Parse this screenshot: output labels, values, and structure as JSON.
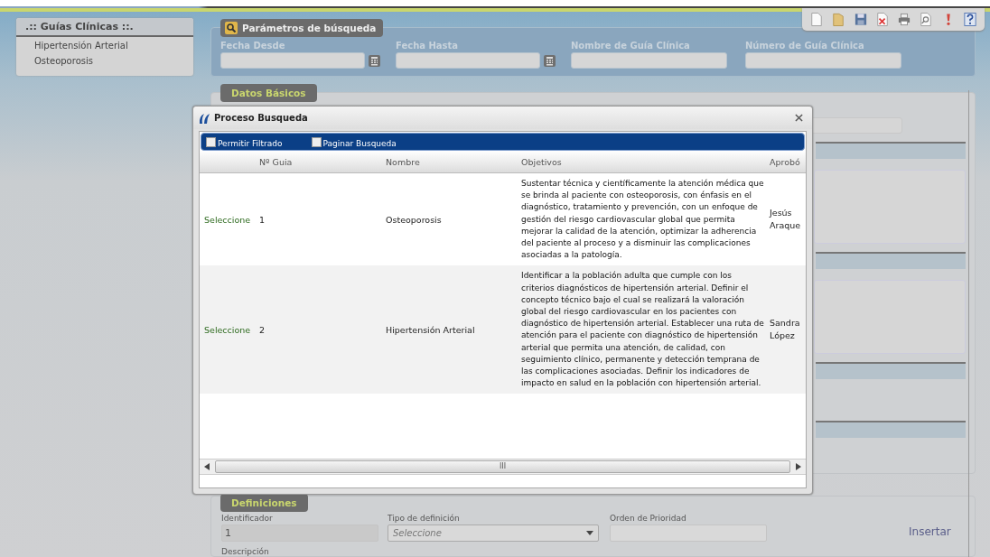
{
  "sidebar": {
    "title": ".:: Guías Clínicas ::.",
    "items": [
      {
        "label": "Hipertensión Arterial",
        "selected": false
      },
      {
        "label": "Osteoporosis",
        "selected": false
      }
    ]
  },
  "toolbar": {
    "buttons": [
      {
        "kind": "new"
      },
      {
        "kind": "open"
      },
      {
        "kind": "save"
      },
      {
        "kind": "delete"
      },
      {
        "kind": "print"
      },
      {
        "kind": "preview"
      },
      {
        "kind": "alert"
      },
      {
        "kind": "help"
      }
    ]
  },
  "search": {
    "legend": "Parámetros de búsqueda",
    "fields": [
      {
        "label": "Fecha Desde",
        "kind": "date"
      },
      {
        "label": "Fecha Hasta",
        "kind": "date"
      },
      {
        "label": "Nombre de Guía Clínica",
        "kind": "text"
      },
      {
        "label": "Número de Guía Clínica",
        "kind": "text"
      }
    ]
  },
  "basic_data": {
    "legend": "Datos Básicos"
  },
  "definitions": {
    "legend": "Definiciones",
    "fields": [
      {
        "label": "Identificador",
        "kind": "text",
        "value": "1",
        "disabled": true
      },
      {
        "label": "Tipo de definición",
        "kind": "select",
        "placeholder": "Seleccione",
        "disabled": false
      },
      {
        "label": "Orden de Prioridad",
        "kind": "text",
        "disabled": false
      }
    ],
    "insert_link": "Insertar",
    "description_label": "Descripción"
  },
  "dialog": {
    "title": "Proceso Busqueda",
    "options": [
      {
        "label": "Permitir Filtrado",
        "checked": false
      },
      {
        "label": "Paginar Busqueda",
        "checked": false
      }
    ],
    "columns": [
      "Nº Guia",
      "Nombre",
      "Objetivos",
      "Aprobó"
    ],
    "rows": [
      {
        "action": "Seleccione",
        "number": "1",
        "name": "Osteoporosis",
        "objectives": "Sustentar técnica y científicamente la atención médica que se brinda al paciente con osteoporosis, con énfasis en el diagnóstico, tratamiento y prevención, con un enfoque de gestión del riesgo cardiovascular global que permita mejorar la calidad de la atención, optimizar la adherencia del paciente al proceso y a disminuir las complicaciones asociadas a la patología.",
        "approved_by": "Jesús Araque"
      },
      {
        "action": "Seleccione",
        "number": "2",
        "name": "Hipertensión Arterial",
        "objectives": "Identificar a la población adulta que cumple con los criterios diagnósticos de hipertensión arterial. Definir el concepto técnico bajo el cual se realizará la valoración global del riesgo cardiovascular en los pacientes con diagnóstico de hipertensión arterial. Establecer una ruta de atención para el paciente con diagnóstico de hipertensión arterial que permita una atención, de calidad, con seguimiento clínico, permanente y detección temprana de las complicaciones asociadas. Definir los indicadores de impacto en salud en la población con hipertensión arterial.",
        "approved_by": "Sandra López"
      }
    ],
    "scrollbar_grip": "III"
  }
}
